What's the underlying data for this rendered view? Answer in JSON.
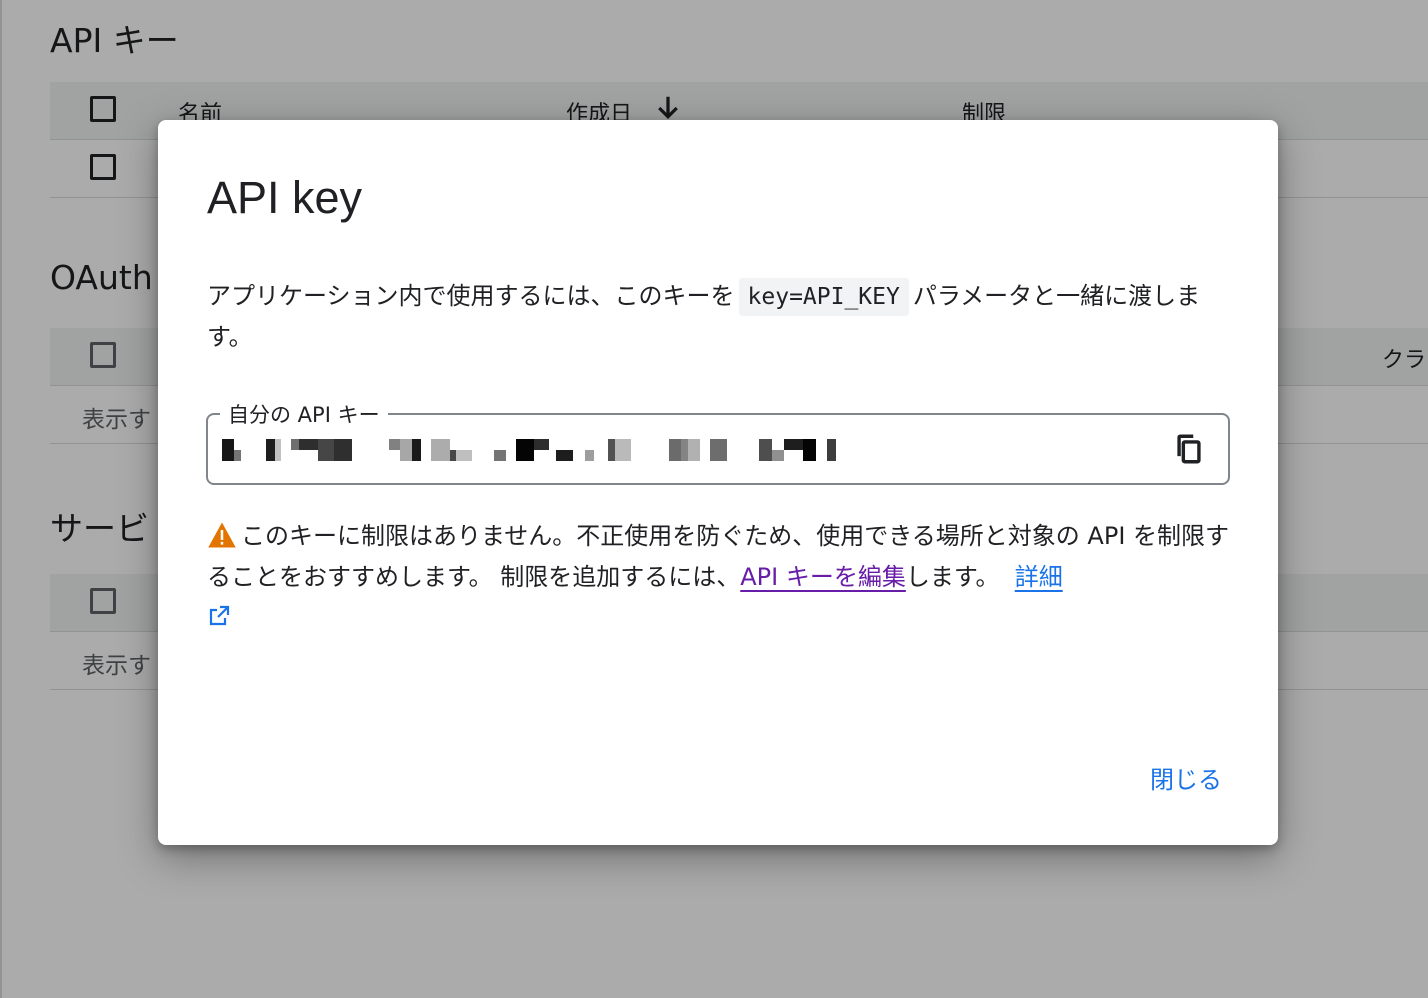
{
  "background": {
    "api_keys_title": "API キー",
    "columns": {
      "name": "名前",
      "created": "作成日",
      "restrictions": "制限"
    },
    "oauth_title": "OAuth",
    "oauth_column_partial": "クラ",
    "oauth_empty_partial": "表示す",
    "services_title": "サービ",
    "services_empty_partial": "表示す"
  },
  "dialog": {
    "title": "API key",
    "description_before": "アプリケーション内で使用するには、このキーを",
    "code": "key=API_KEY",
    "description_after": "パラメータと一緒に渡します。",
    "field_label": "自分の API キー",
    "warning_text": "このキーに制限はありません。不正使用を防ぐため、使用できる場所と対象の API を制限することをおすすめします。 制限を追加するには、",
    "edit_link": "API キーを編集",
    "after_link": "します。",
    "learn_more": "詳細",
    "close_label": "閉じる"
  },
  "icons": {
    "copy": "copy-icon",
    "warning": "warning-icon",
    "external": "external-link-icon",
    "sort": "arrow-down-icon"
  },
  "colors": {
    "link_visited": "#681da8",
    "link": "#1a73e8",
    "warning": "#e37400"
  }
}
